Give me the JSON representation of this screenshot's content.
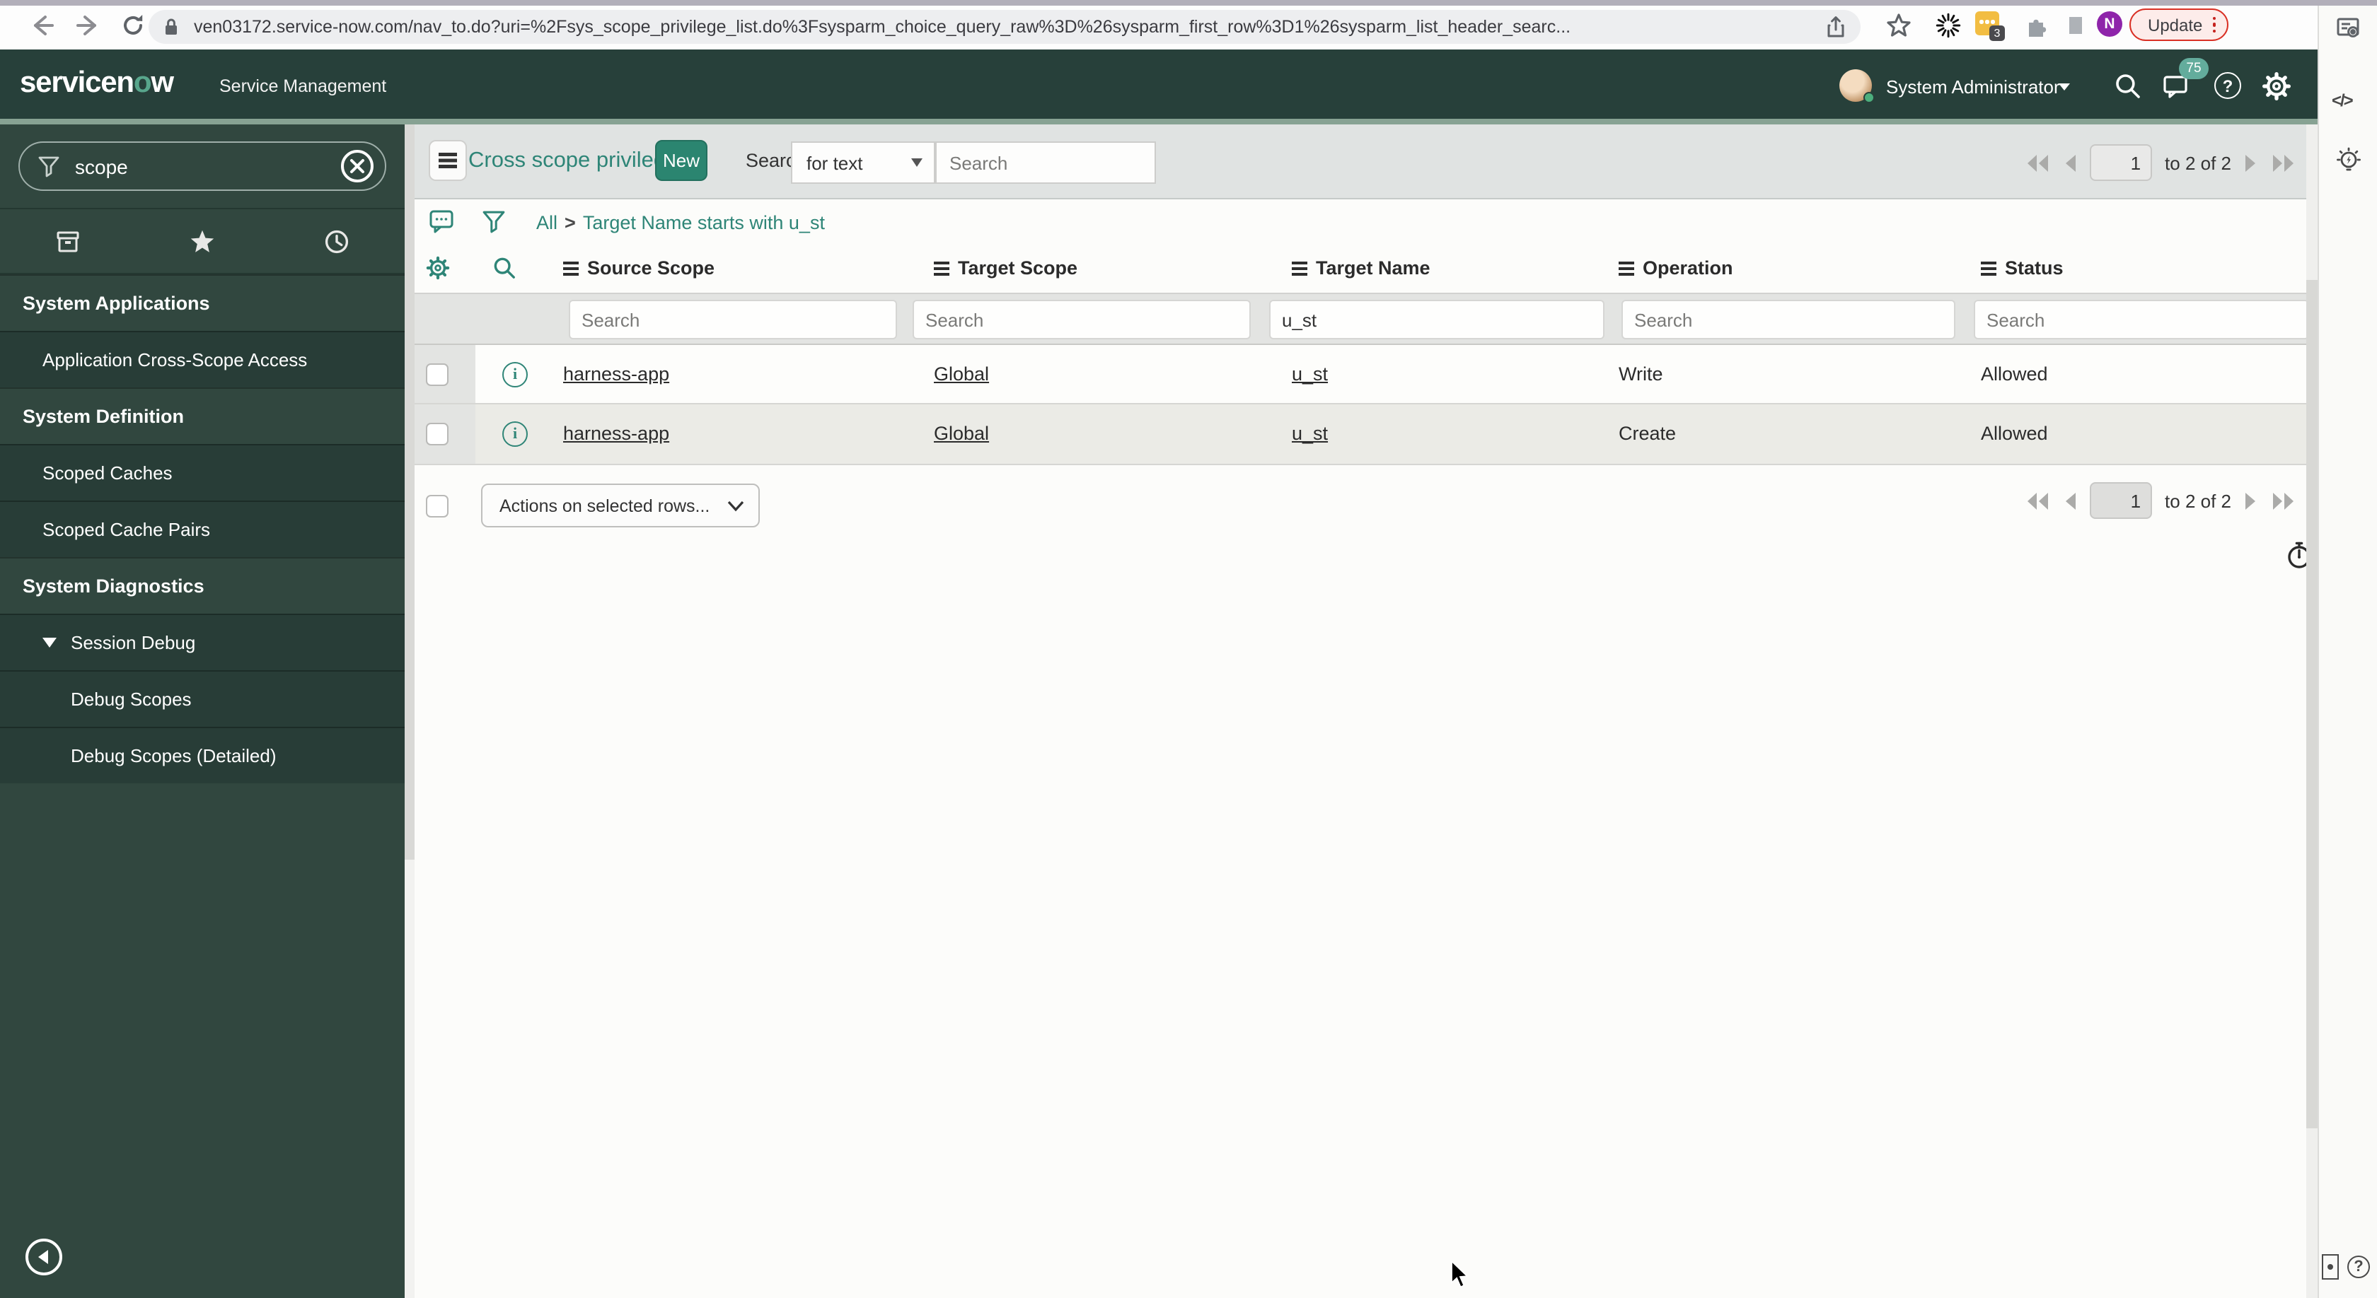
{
  "browser": {
    "url": "ven03172.service-now.com/nav_to.do?uri=%2Fsys_scope_privilege_list.do%3Fsysparm_choice_query_raw%3D%26sysparm_first_row%3D1%26sysparm_list_header_searc...",
    "update_label": "Update",
    "extension_badge": "3",
    "profile_initial": "N"
  },
  "rail": {
    "code_glyph": "</>",
    "help_glyph": "?"
  },
  "app_header": {
    "logo_pre": "servicen",
    "logo_o": "o",
    "logo_post": "w",
    "product": "Service Management",
    "user": "System Administrator",
    "notification_count": "75",
    "help_glyph": "?"
  },
  "sidebar": {
    "filter_value": "scope",
    "items": [
      {
        "label": "System Applications"
      },
      {
        "label": "Application Cross-Scope Access"
      },
      {
        "label": "System Definition"
      },
      {
        "label": "Scoped Caches"
      },
      {
        "label": "Scoped Cache Pairs"
      },
      {
        "label": "System Diagnostics"
      },
      {
        "label": "Session Debug"
      },
      {
        "label": "Debug Scopes"
      },
      {
        "label": "Debug Scopes (Detailed)"
      }
    ]
  },
  "list": {
    "title": "Cross scope privileges",
    "new_button": "New",
    "search_label": "Search",
    "search_type": "for text",
    "search_placeholder": "Search",
    "breadcrumb": {
      "all": "All",
      "separator": ">",
      "filter": "Target Name starts with u_st"
    },
    "pager": {
      "page": "1",
      "range": "to 2 of 2"
    },
    "columns": [
      "Source Scope",
      "Target Scope",
      "Target Name",
      "Operation",
      "Status"
    ],
    "filters": {
      "source_scope_placeholder": "Search",
      "target_scope_placeholder": "Search",
      "target_name_value": "u_st",
      "operation_placeholder": "Search",
      "status_placeholder": "Search"
    },
    "rows": [
      {
        "source_scope": "harness-app",
        "target_scope": "Global",
        "target_name": "u_st",
        "operation": "Write",
        "status": "Allowed"
      },
      {
        "source_scope": "harness-app",
        "target_scope": "Global",
        "target_name": "u_st",
        "operation": "Create",
        "status": "Allowed"
      }
    ],
    "actions_label": "Actions on selected rows...",
    "info_glyph": "i"
  }
}
